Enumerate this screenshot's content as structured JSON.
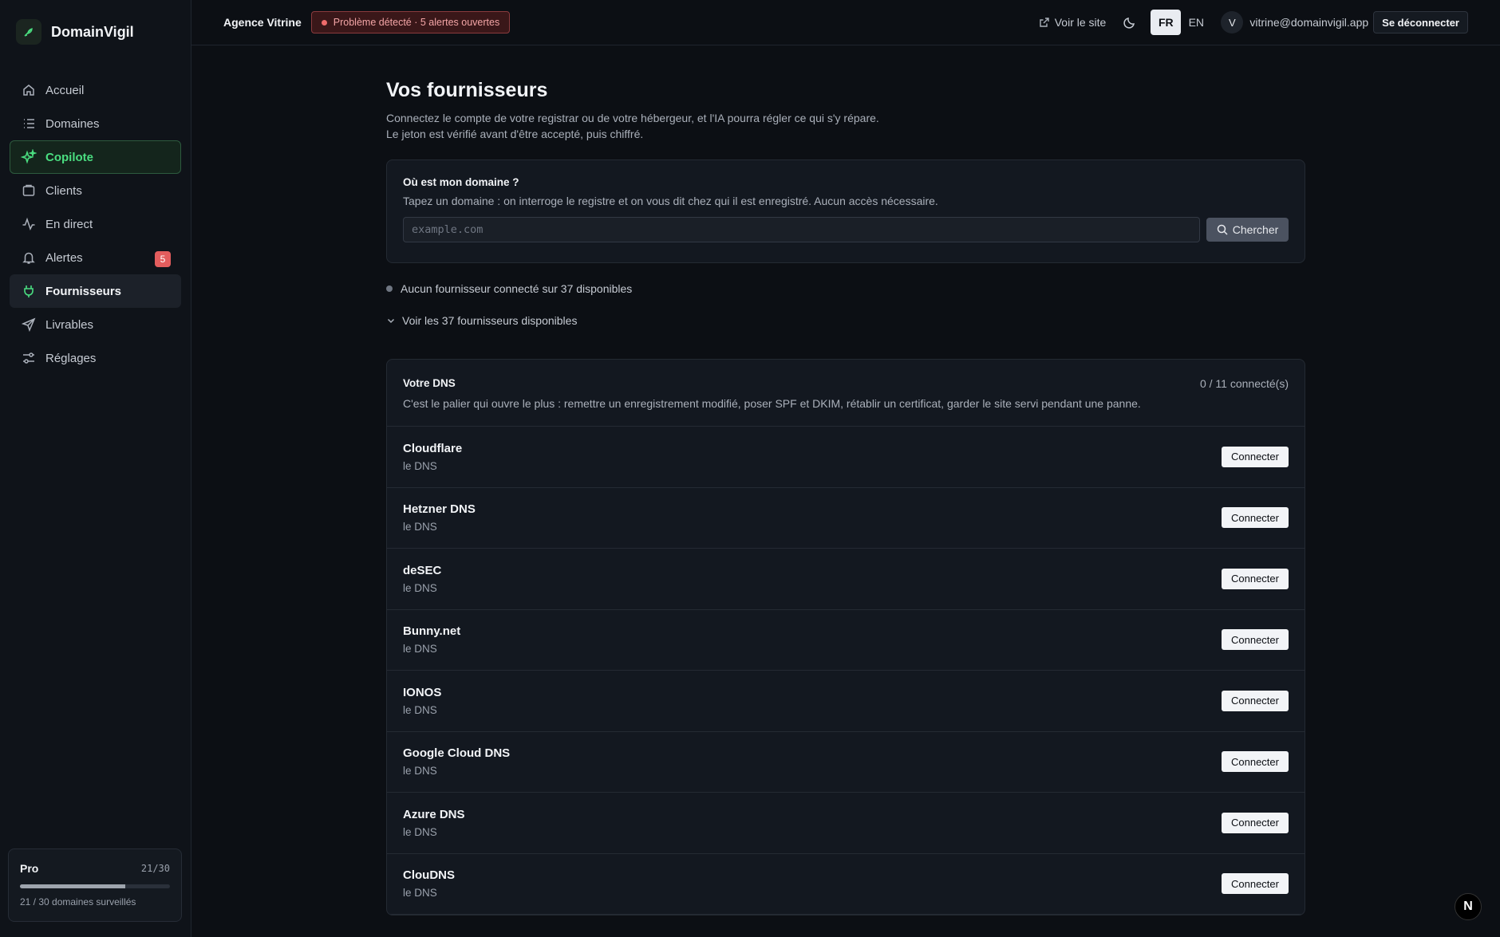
{
  "brand": {
    "name": "DomainVigil",
    "logo_icon": "sprout-icon"
  },
  "sidebar": {
    "items": [
      {
        "label": "Accueil",
        "icon": "home-icon"
      },
      {
        "label": "Domaines",
        "icon": "list-icon"
      },
      {
        "label": "Copilote",
        "icon": "sparkles-icon",
        "highlight": true
      },
      {
        "label": "Clients",
        "icon": "folder-icon"
      },
      {
        "label": "En direct",
        "icon": "activity-icon"
      },
      {
        "label": "Alertes",
        "icon": "bell-icon",
        "badge": "5"
      },
      {
        "label": "Fournisseurs",
        "icon": "plug-icon",
        "active": true
      },
      {
        "label": "Livrables",
        "icon": "send-icon"
      },
      {
        "label": "Réglages",
        "icon": "sliders-icon"
      }
    ],
    "plan": {
      "name": "Pro",
      "fraction": "21/30",
      "progress": 0.7,
      "caption": "21 / 30 domaines surveillés"
    }
  },
  "topbar": {
    "org": "Agence Vitrine",
    "alert": "Problème détecté · 5 alertes ouvertes",
    "visit_site": "Voir le site",
    "lang_fr": "FR",
    "lang_en": "EN",
    "avatar_initial": "V",
    "email": "vitrine@domainvigil.app",
    "logout": "Se déconnecter"
  },
  "page": {
    "title": "Vos fournisseurs",
    "subtitle_1": "Connectez le compte de votre registrar ou de votre hébergeur, et l'IA pourra régler ce qui s'y répare.",
    "subtitle_2": "Le jeton est vérifié avant d'être accepté, puis chiffré."
  },
  "lookup": {
    "title": "Où est mon domaine ?",
    "description": "Tapez un domaine : on interroge le registre et on vous dit chez qui il est enregistré. Aucun accès nécessaire.",
    "placeholder": "example.com",
    "button": "Chercher"
  },
  "status": {
    "summary": "Aucun fournisseur connecté sur 37 disponibles",
    "expander": "Voir les 37 fournisseurs disponibles"
  },
  "dns_section": {
    "title": "Votre DNS",
    "count": "0 / 11 connecté(s)",
    "description": "C'est le palier qui ouvre le plus : remettre un enregistrement modifié, poser SPF et DKIM, rétablir un certificat, garder le site servi pendant une panne.",
    "connect_label": "Connecter",
    "providers": [
      {
        "name": "Cloudflare",
        "type": "le DNS"
      },
      {
        "name": "Hetzner DNS",
        "type": "le DNS"
      },
      {
        "name": "deSEC",
        "type": "le DNS"
      },
      {
        "name": "Bunny.net",
        "type": "le DNS"
      },
      {
        "name": "IONOS",
        "type": "le DNS"
      },
      {
        "name": "Google Cloud DNS",
        "type": "le DNS"
      },
      {
        "name": "Azure DNS",
        "type": "le DNS"
      },
      {
        "name": "ClouDNS",
        "type": "le DNS"
      }
    ]
  },
  "floating": {
    "next_badge": "N"
  }
}
